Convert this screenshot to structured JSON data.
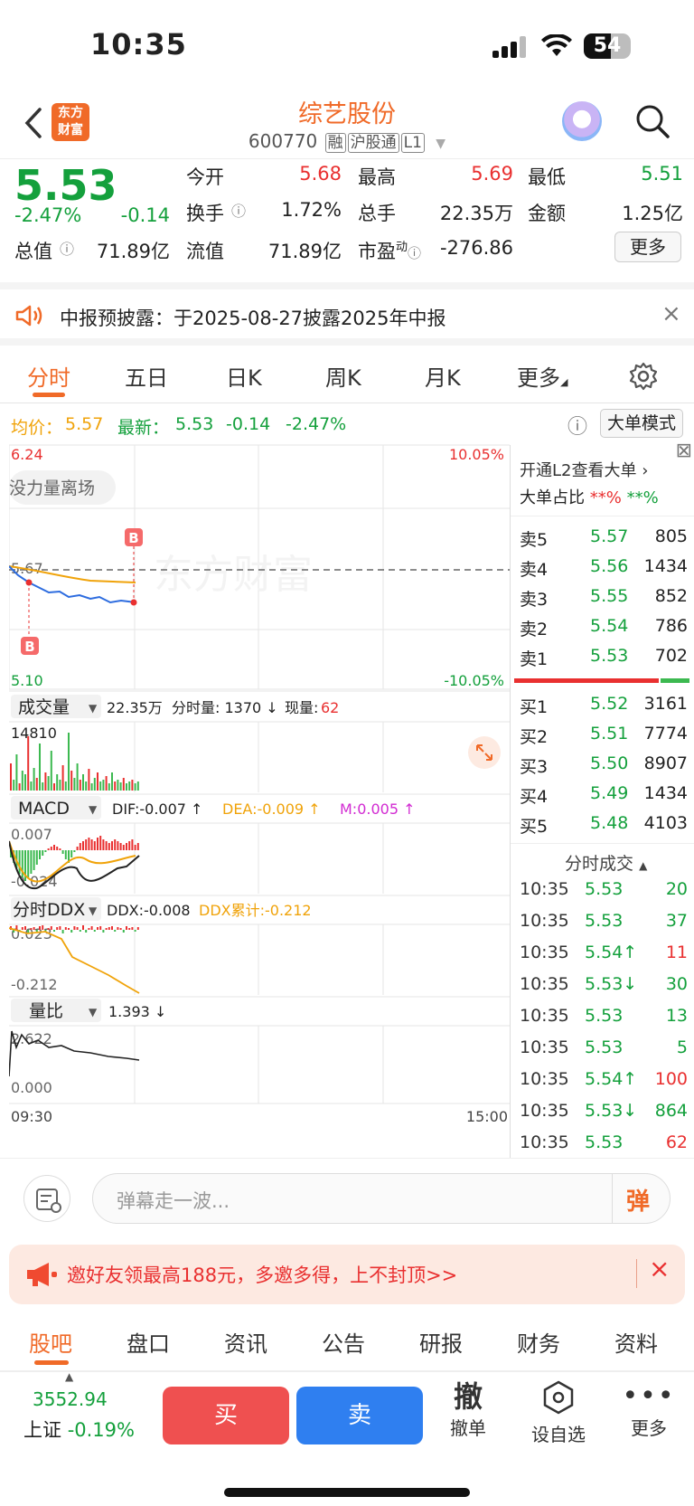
{
  "status_bar": {
    "time": "10:35",
    "battery": "54"
  },
  "header": {
    "logo": "东方\n财富",
    "title": "综艺股份",
    "code": "600770",
    "tags": [
      "融",
      "沪股通",
      "L1"
    ]
  },
  "quote": {
    "price": "5.53",
    "change_pct": "-2.47%",
    "change": "-0.14",
    "open_label": "今开",
    "open": "5.68",
    "high_label": "最高",
    "high": "5.69",
    "low_label": "最低",
    "low": "5.51",
    "turnover_label": "换手",
    "turnover": "1.72%",
    "volume_label": "总手",
    "volume": "22.35万",
    "amount_label": "金额",
    "amount": "1.25亿",
    "mktcap_label": "总值",
    "mktcap": "71.89亿",
    "float_label": "流值",
    "float": "71.89亿",
    "pe_label": "市盈",
    "pe_sup": "动",
    "pe": "-276.86",
    "more_button": "更多"
  },
  "notice": {
    "text": "中报预披露：于2025-08-27披露2025年中报"
  },
  "chart_tabs": [
    {
      "label": "分时"
    },
    {
      "label": "五日"
    },
    {
      "label": "日K"
    },
    {
      "label": "周K"
    },
    {
      "label": "月K"
    },
    {
      "label": "更多"
    }
  ],
  "avg_bar": {
    "avg_label": "均价：",
    "avg": "5.57",
    "latest_label": "最新：",
    "latest": "5.53",
    "chg": "-0.14",
    "chg_pct": "-2.47%",
    "mode_button": "大单模式"
  },
  "chart": {
    "y_top": "6.24",
    "y_ref": "5.67",
    "y_bottom": "5.10",
    "pct_top": "10.05%",
    "pct_bottom": "-10.05%",
    "watermark": "东方财富",
    "floating_tag": "没力量离场",
    "marker_b": "B",
    "vol_selector": "成交量",
    "vol_info_total": "22.35万",
    "vol_info_fs": "分时量: 1370 ↓",
    "vol_info_now_label": "现量:",
    "vol_info_now": "62",
    "vol_max": "14810",
    "macd_selector": "MACD",
    "dif": "DIF:-0.007 ↑",
    "dea": "DEA:-0.009 ↑",
    "m": "M:0.005 ↑",
    "macd_top": "0.007",
    "macd_bottom": "-0.024",
    "ddx_selector": "分时DDX",
    "ddx": "DDX:-0.008",
    "ddx_sum": "DDX累计:-0.212",
    "ddx_top": "0.023",
    "ddx_bottom": "-0.212",
    "lb_selector": "量比",
    "lb_value": "1.393 ↓",
    "lb_top": "2.622",
    "lb_bottom": "0.000",
    "x_start": "09:30",
    "x_end": "15:00"
  },
  "right_panel": {
    "l2_link": "开通L2查看大单",
    "big_ratio_label": "大单占比",
    "big_ratio_red": "**%",
    "big_ratio_green": "**%",
    "asks": [
      {
        "label": "卖5",
        "price": "5.57",
        "vol": "805"
      },
      {
        "label": "卖4",
        "price": "5.56",
        "vol": "1434"
      },
      {
        "label": "卖3",
        "price": "5.55",
        "vol": "852"
      },
      {
        "label": "卖2",
        "price": "5.54",
        "vol": "786"
      },
      {
        "label": "卖1",
        "price": "5.53",
        "vol": "702"
      }
    ],
    "bids": [
      {
        "label": "买1",
        "price": "5.52",
        "vol": "3161"
      },
      {
        "label": "买2",
        "price": "5.51",
        "vol": "7774"
      },
      {
        "label": "买3",
        "price": "5.50",
        "vol": "8907"
      },
      {
        "label": "买4",
        "price": "5.49",
        "vol": "1434"
      },
      {
        "label": "买5",
        "price": "5.48",
        "vol": "4103"
      }
    ],
    "ticks_title": "分时成交",
    "ticks": [
      {
        "time": "10:35",
        "price": "5.53",
        "vol": "20"
      },
      {
        "time": "10:35",
        "price": "5.53",
        "vol": "37"
      },
      {
        "time": "10:35",
        "price": "5.54↑",
        "vol": "11"
      },
      {
        "time": "10:35",
        "price": "5.53↓",
        "vol": "30"
      },
      {
        "time": "10:35",
        "price": "5.53",
        "vol": "13"
      },
      {
        "time": "10:35",
        "price": "5.53",
        "vol": "5"
      },
      {
        "time": "10:35",
        "price": "5.54↑",
        "vol": "100"
      },
      {
        "time": "10:35",
        "price": "5.53↓",
        "vol": "864"
      },
      {
        "time": "10:35",
        "price": "5.53",
        "vol": "62"
      }
    ]
  },
  "danmu": {
    "placeholder": "弹幕走一波...",
    "send_icon": "弹"
  },
  "promo": {
    "text": "邀好友领最高188元，多邀多得，上不封顶>>"
  },
  "bottom_tabs": [
    {
      "label": "股吧"
    },
    {
      "label": "盘口"
    },
    {
      "label": "资讯"
    },
    {
      "label": "公告"
    },
    {
      "label": "研报"
    },
    {
      "label": "财务"
    },
    {
      "label": "资料"
    }
  ],
  "bottom_bar": {
    "index_value": "3552.94",
    "index_name": "上证",
    "index_chg": "-0.19%",
    "buy": "买",
    "sell": "卖",
    "cancel_glyph": "撤",
    "cancel": "撤单",
    "watch": "设自选",
    "more": "更多"
  }
}
